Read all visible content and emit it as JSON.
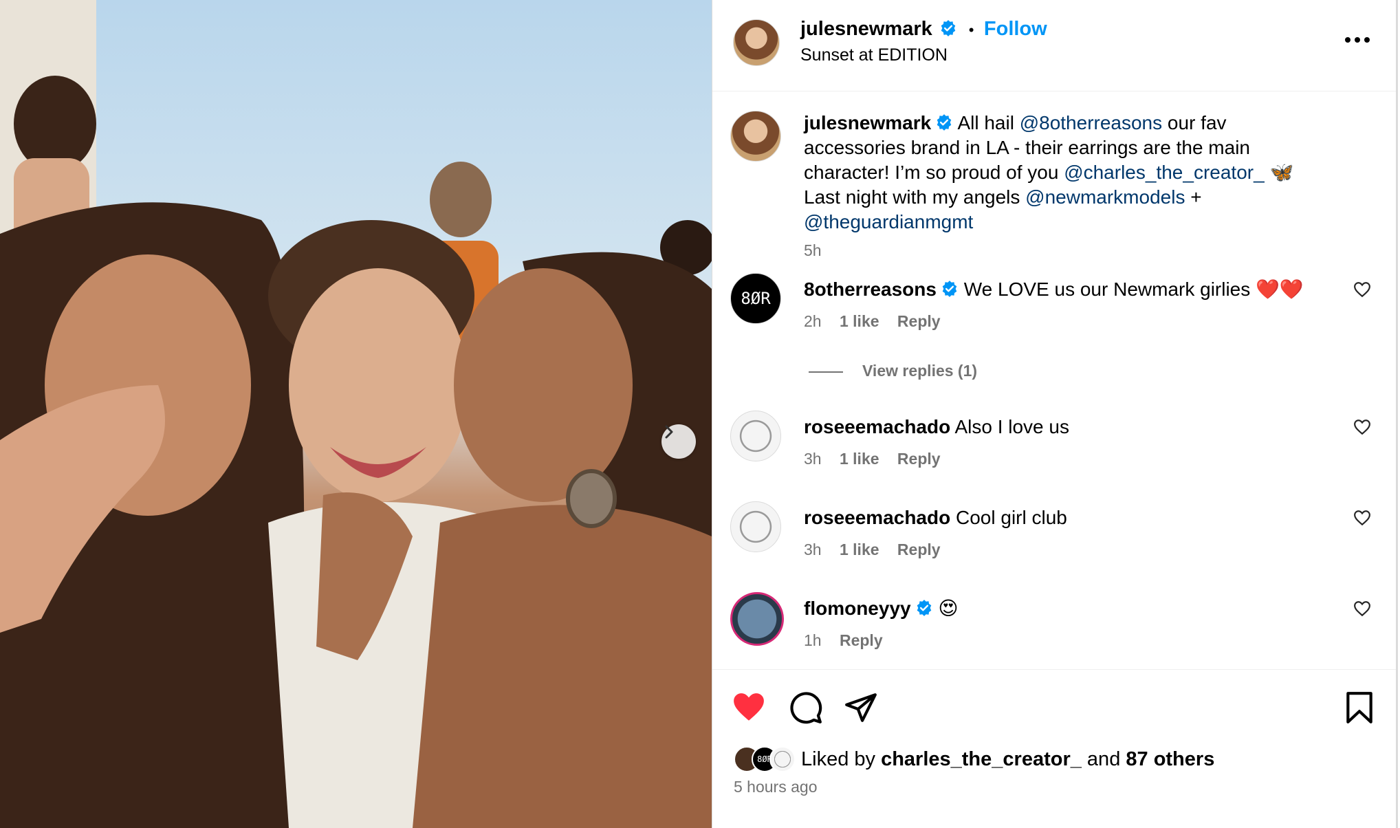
{
  "post": {
    "author": "julesnewmark",
    "follow_label": "Follow",
    "dot": "•",
    "location": "Sunset at EDITION"
  },
  "caption": {
    "username": "julesnewmark",
    "text_1": "All hail ",
    "mention_1": "@8otherreasons",
    "text_2": " our fav accessories brand in LA - their earrings are the main character! I’m so proud of you ",
    "mention_2": "@charles_the_creator_",
    "text_3": " 🦋 Last night with my angels ",
    "mention_3": "@newmarkmodels",
    "text_4": " + ",
    "mention_4": "@theguardianmgmt",
    "time": "5h"
  },
  "comments": [
    {
      "username": "8otherreasons",
      "text": "We LOVE us our Newmark girlies ❤️❤️",
      "time": "2h",
      "likes": "1 like",
      "reply": "Reply",
      "verified": true
    },
    {
      "username": "roseeemachado",
      "text": "Also I love us",
      "time": "3h",
      "likes": "1 like",
      "reply": "Reply",
      "verified": false
    },
    {
      "username": "roseeemachado",
      "text": "Cool girl club",
      "time": "3h",
      "likes": "1 like",
      "reply": "Reply",
      "verified": false
    },
    {
      "username": "flomoneyyy",
      "text": "😍",
      "time": "1h",
      "reply": "Reply",
      "verified": true
    }
  ],
  "view_replies": "View replies (1)",
  "avatar_logo_text": "8ØR",
  "likes": {
    "prefix": "Liked by ",
    "user": "charles_the_creator_",
    "middle": " and ",
    "others": "87 others"
  },
  "timestamp": "5 hours ago",
  "colors": {
    "accent": "#0095f6",
    "mention": "#00376b",
    "like_red": "#ff3040",
    "verified": "#0095f6",
    "meta_gray": "#737373"
  },
  "icons": [
    "chevron-right-icon",
    "verified-icon",
    "more-icon",
    "heart-icon",
    "comment-icon",
    "share-icon",
    "bookmark-icon"
  ]
}
